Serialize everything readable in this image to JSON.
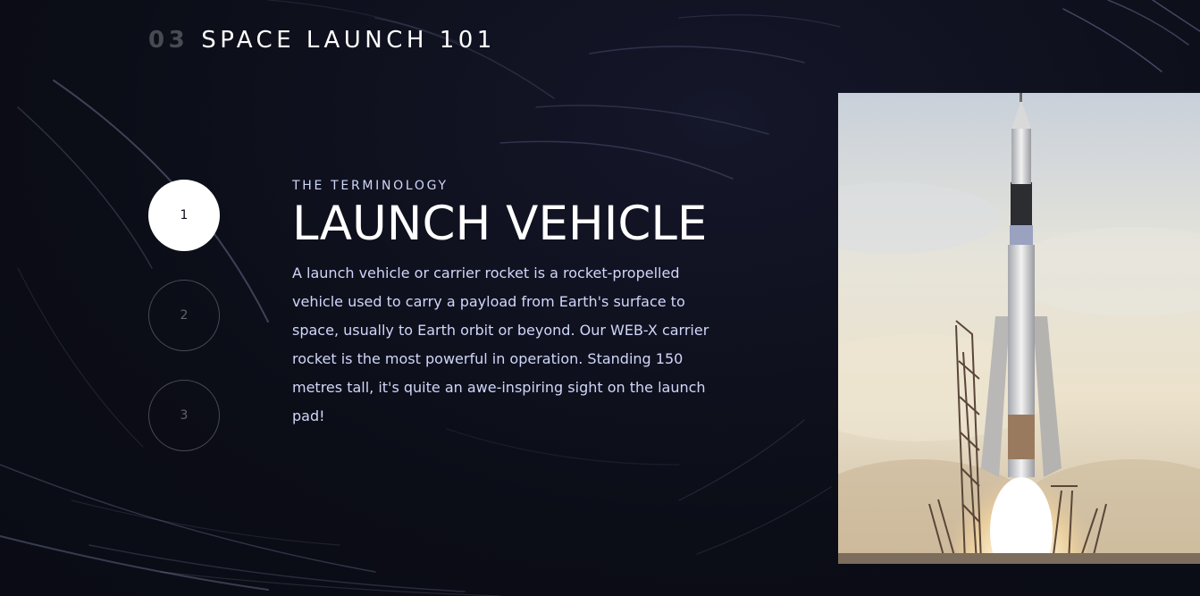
{
  "header": {
    "number": "03",
    "title": "SPACE LAUNCH 101"
  },
  "steps": [
    {
      "label": "1",
      "active": true
    },
    {
      "label": "2",
      "active": false
    },
    {
      "label": "3",
      "active": false
    }
  ],
  "content": {
    "eyebrow": "THE TERMINOLOGY",
    "title": "LAUNCH VEHICLE",
    "description": "A launch vehicle or carrier rocket is a rocket-propelled vehicle used to carry a payload from Earth's surface to space, usually to Earth orbit or beyond. Our WEB-X carrier rocket is the most powerful in operation. Standing 150 metres tall, it's quite an awe-inspiring sight on the launch pad!"
  },
  "colors": {
    "background": "#0b0d17",
    "text": "#ffffff",
    "accent_text": "#d0d6f9"
  },
  "image": {
    "icon": "rocket-launch-photo"
  }
}
